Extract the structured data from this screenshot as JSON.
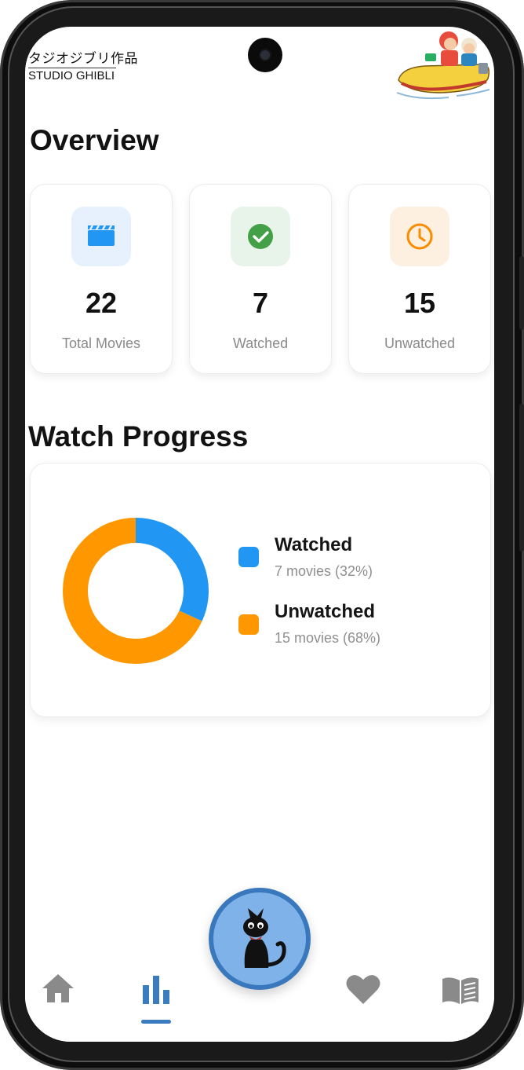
{
  "header": {
    "logo_jp": "タジオジブリ作品",
    "logo_en": "STUDIO GHIBLI"
  },
  "overview": {
    "title": "Overview",
    "cards": [
      {
        "value": "22",
        "label": "Total Movies",
        "icon": "clapperboard-icon",
        "color": "#2196F3",
        "bg": "#E6F1FD"
      },
      {
        "value": "7",
        "label": "Watched",
        "icon": "check-circle-icon",
        "color": "#43A047",
        "bg": "#E8F3E9"
      },
      {
        "value": "15",
        "label": "Unwatched",
        "icon": "clock-icon",
        "color": "#FB8C00",
        "bg": "#FDF0E0"
      }
    ]
  },
  "progress": {
    "title": "Watch Progress",
    "legend": [
      {
        "label": "Watched",
        "detail": "7 movies (32%)",
        "color": "#2196F3"
      },
      {
        "label": "Unwatched",
        "detail": "15 movies (68%)",
        "color": "#FF9800"
      }
    ]
  },
  "chart_data": {
    "type": "pie",
    "categories": [
      "Watched",
      "Unwatched"
    ],
    "values": [
      7,
      15
    ],
    "colors": [
      "#2196F3",
      "#FF9800"
    ],
    "donut": true
  },
  "nav": {
    "items": [
      {
        "name": "home",
        "icon": "home-icon",
        "active": false
      },
      {
        "name": "stats",
        "icon": "bar-chart-icon",
        "active": true
      },
      {
        "name": "favorites",
        "icon": "heart-icon",
        "active": false
      },
      {
        "name": "library",
        "icon": "book-icon",
        "active": false
      }
    ],
    "center_icon": "black-cat-icon",
    "active_color": "#3B7CC0",
    "inactive_color": "#8A8A8A"
  }
}
